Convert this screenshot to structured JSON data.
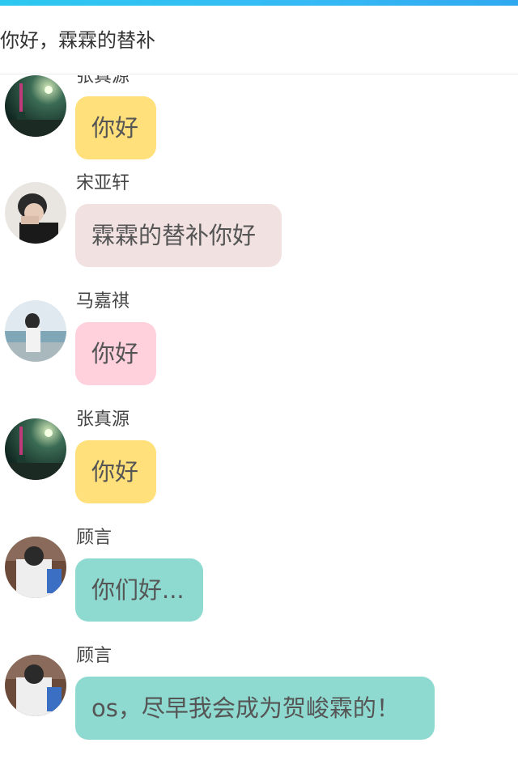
{
  "header": {
    "title": "你好，霖霖的替补"
  },
  "messages": [
    {
      "sender": "张真源",
      "text": "你好",
      "bubble_color": "#ffe07a",
      "avatar_icon": "city-night-icon"
    },
    {
      "sender": "宋亚轩",
      "text": "霖霖的替补你好",
      "bubble_color": "#f1e1e1",
      "avatar_icon": "person-photo-icon"
    },
    {
      "sender": "马嘉祺",
      "text": "你好",
      "bubble_color": "#ffd1dc",
      "avatar_icon": "person-photo-icon"
    },
    {
      "sender": "张真源",
      "text": "你好",
      "bubble_color": "#ffe07a",
      "avatar_icon": "city-night-icon"
    },
    {
      "sender": "顾言",
      "text": "你们好...",
      "bubble_color": "#8fdad0",
      "avatar_icon": "person-photo-icon"
    },
    {
      "sender": "顾言",
      "text": "os，尽早我会成为贺峻霖的！",
      "bubble_color": "#8fdad0",
      "avatar_icon": "person-photo-icon"
    }
  ]
}
